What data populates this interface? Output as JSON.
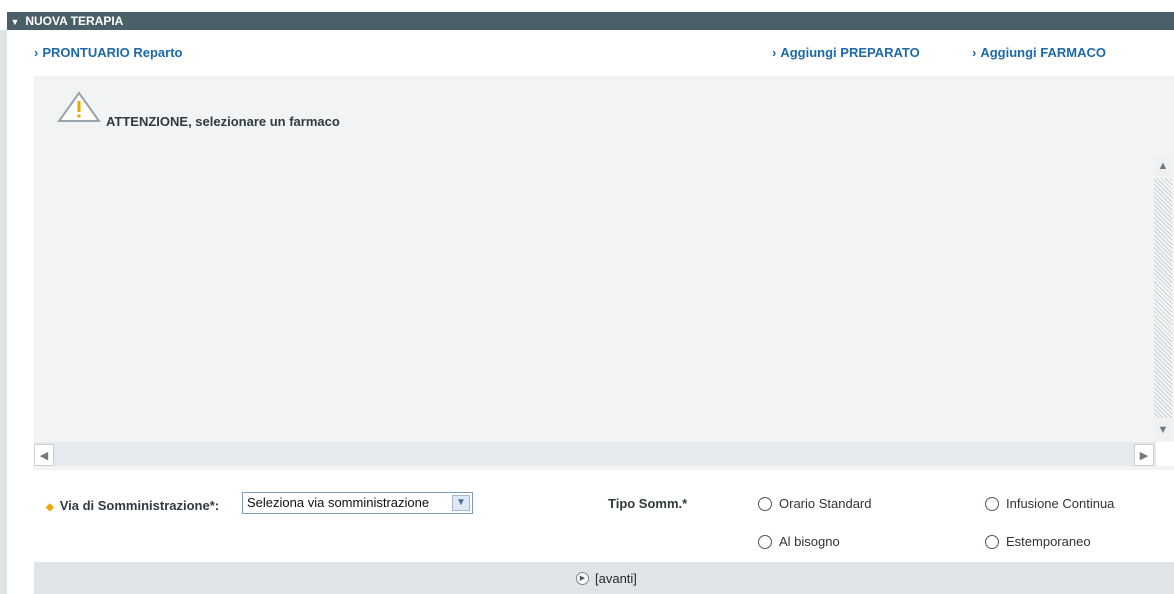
{
  "header": {
    "title": "NUOVA TERAPIA",
    "caret_icon": "caret-down-icon"
  },
  "links": {
    "prontuario": "PRONTUARIO Reparto",
    "aggiungi_preparato": "Aggiungi PREPARATO",
    "aggiungi_farmaco": "Aggiungi FARMACO"
  },
  "warning": {
    "text": "ATTENZIONE, selezionare un farmaco",
    "icon": "warning-triangle-icon"
  },
  "form": {
    "via_label": "Via di Somministrazione*:",
    "via_select_value": "Seleziona via somministrazione",
    "tipo_label": "Tipo Somm.*",
    "radios": [
      "Orario Standard",
      "Infusione Continua",
      "Al bisogno",
      "Estemporaneo"
    ]
  },
  "footer": {
    "avanti": "[avanti]"
  },
  "colors": {
    "header_bg": "#4a5f67",
    "link": "#1d6aa6",
    "panel_bg": "#f1f3f4",
    "required_dot": "#f0a500"
  }
}
